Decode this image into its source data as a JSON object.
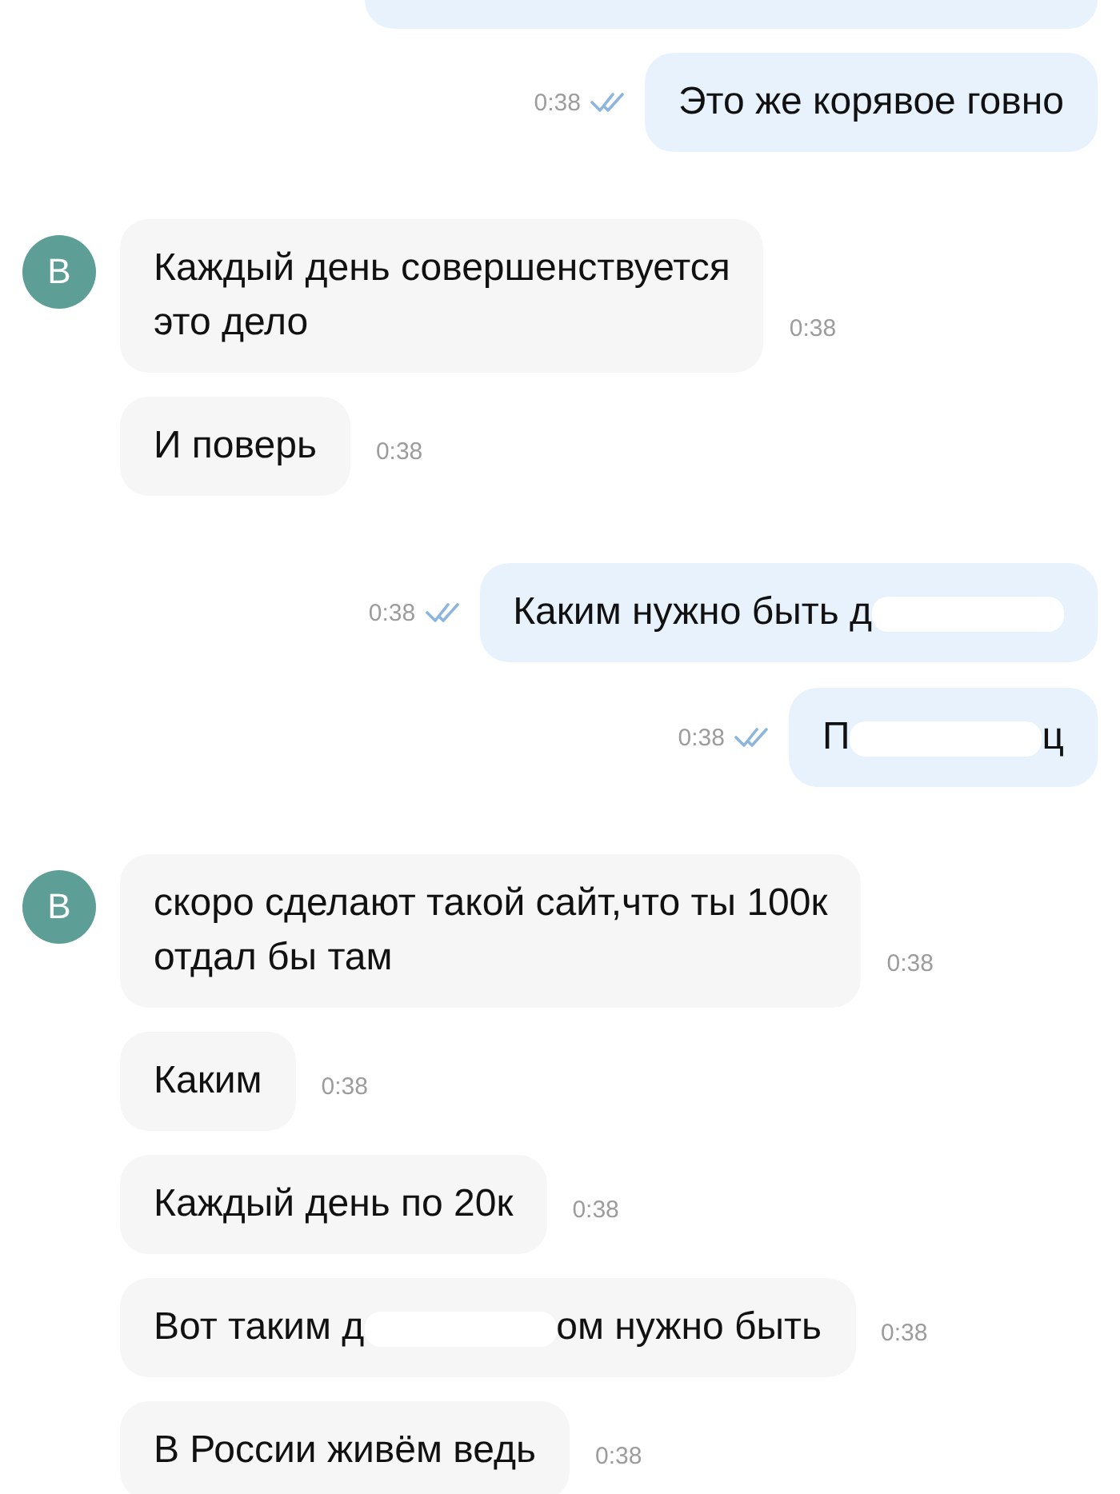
{
  "chat": [
    {
      "kind": "outgoing_cut"
    },
    {
      "kind": "outgoing",
      "parts": [
        {
          "kind": "text",
          "text": "Это же корявое говно"
        }
      ],
      "time": "0:38",
      "read": true
    },
    {
      "kind": "incoming",
      "avatar": "В",
      "messages": [
        {
          "parts": [
            {
              "kind": "text",
              "text": "Каждый день совершенствуется\nэто дело"
            }
          ],
          "time": "0:38"
        },
        {
          "parts": [
            {
              "kind": "text",
              "text": "И поверь"
            }
          ],
          "time": "0:38"
        }
      ]
    },
    {
      "kind": "outgoing",
      "parts": [
        {
          "kind": "text",
          "text": "Каким нужно быть д"
        },
        {
          "kind": "redacted"
        }
      ],
      "time": "0:38",
      "read": true
    },
    {
      "kind": "outgoing",
      "parts": [
        {
          "kind": "text",
          "text": "П"
        },
        {
          "kind": "redacted"
        },
        {
          "kind": "text",
          "text": "ц"
        }
      ],
      "time": "0:38",
      "read": true
    },
    {
      "kind": "incoming",
      "avatar": "В",
      "messages": [
        {
          "parts": [
            {
              "kind": "text",
              "text": "скоро сделают такой сайт,что ты 100к\nотдал бы там"
            }
          ],
          "time": "0:38"
        },
        {
          "parts": [
            {
              "kind": "text",
              "text": "Каким"
            }
          ],
          "time": "0:38"
        },
        {
          "parts": [
            {
              "kind": "text",
              "text": "Каждый день по 20к"
            }
          ],
          "time": "0:38"
        },
        {
          "parts": [
            {
              "kind": "text",
              "text": "Вот таким д"
            },
            {
              "kind": "redacted"
            },
            {
              "kind": "text",
              "text": "ом нужно быть"
            }
          ],
          "time": "0:38"
        },
        {
          "parts": [
            {
              "kind": "text",
              "text": "В России живём ведь"
            }
          ],
          "time": "0:38"
        }
      ]
    }
  ]
}
